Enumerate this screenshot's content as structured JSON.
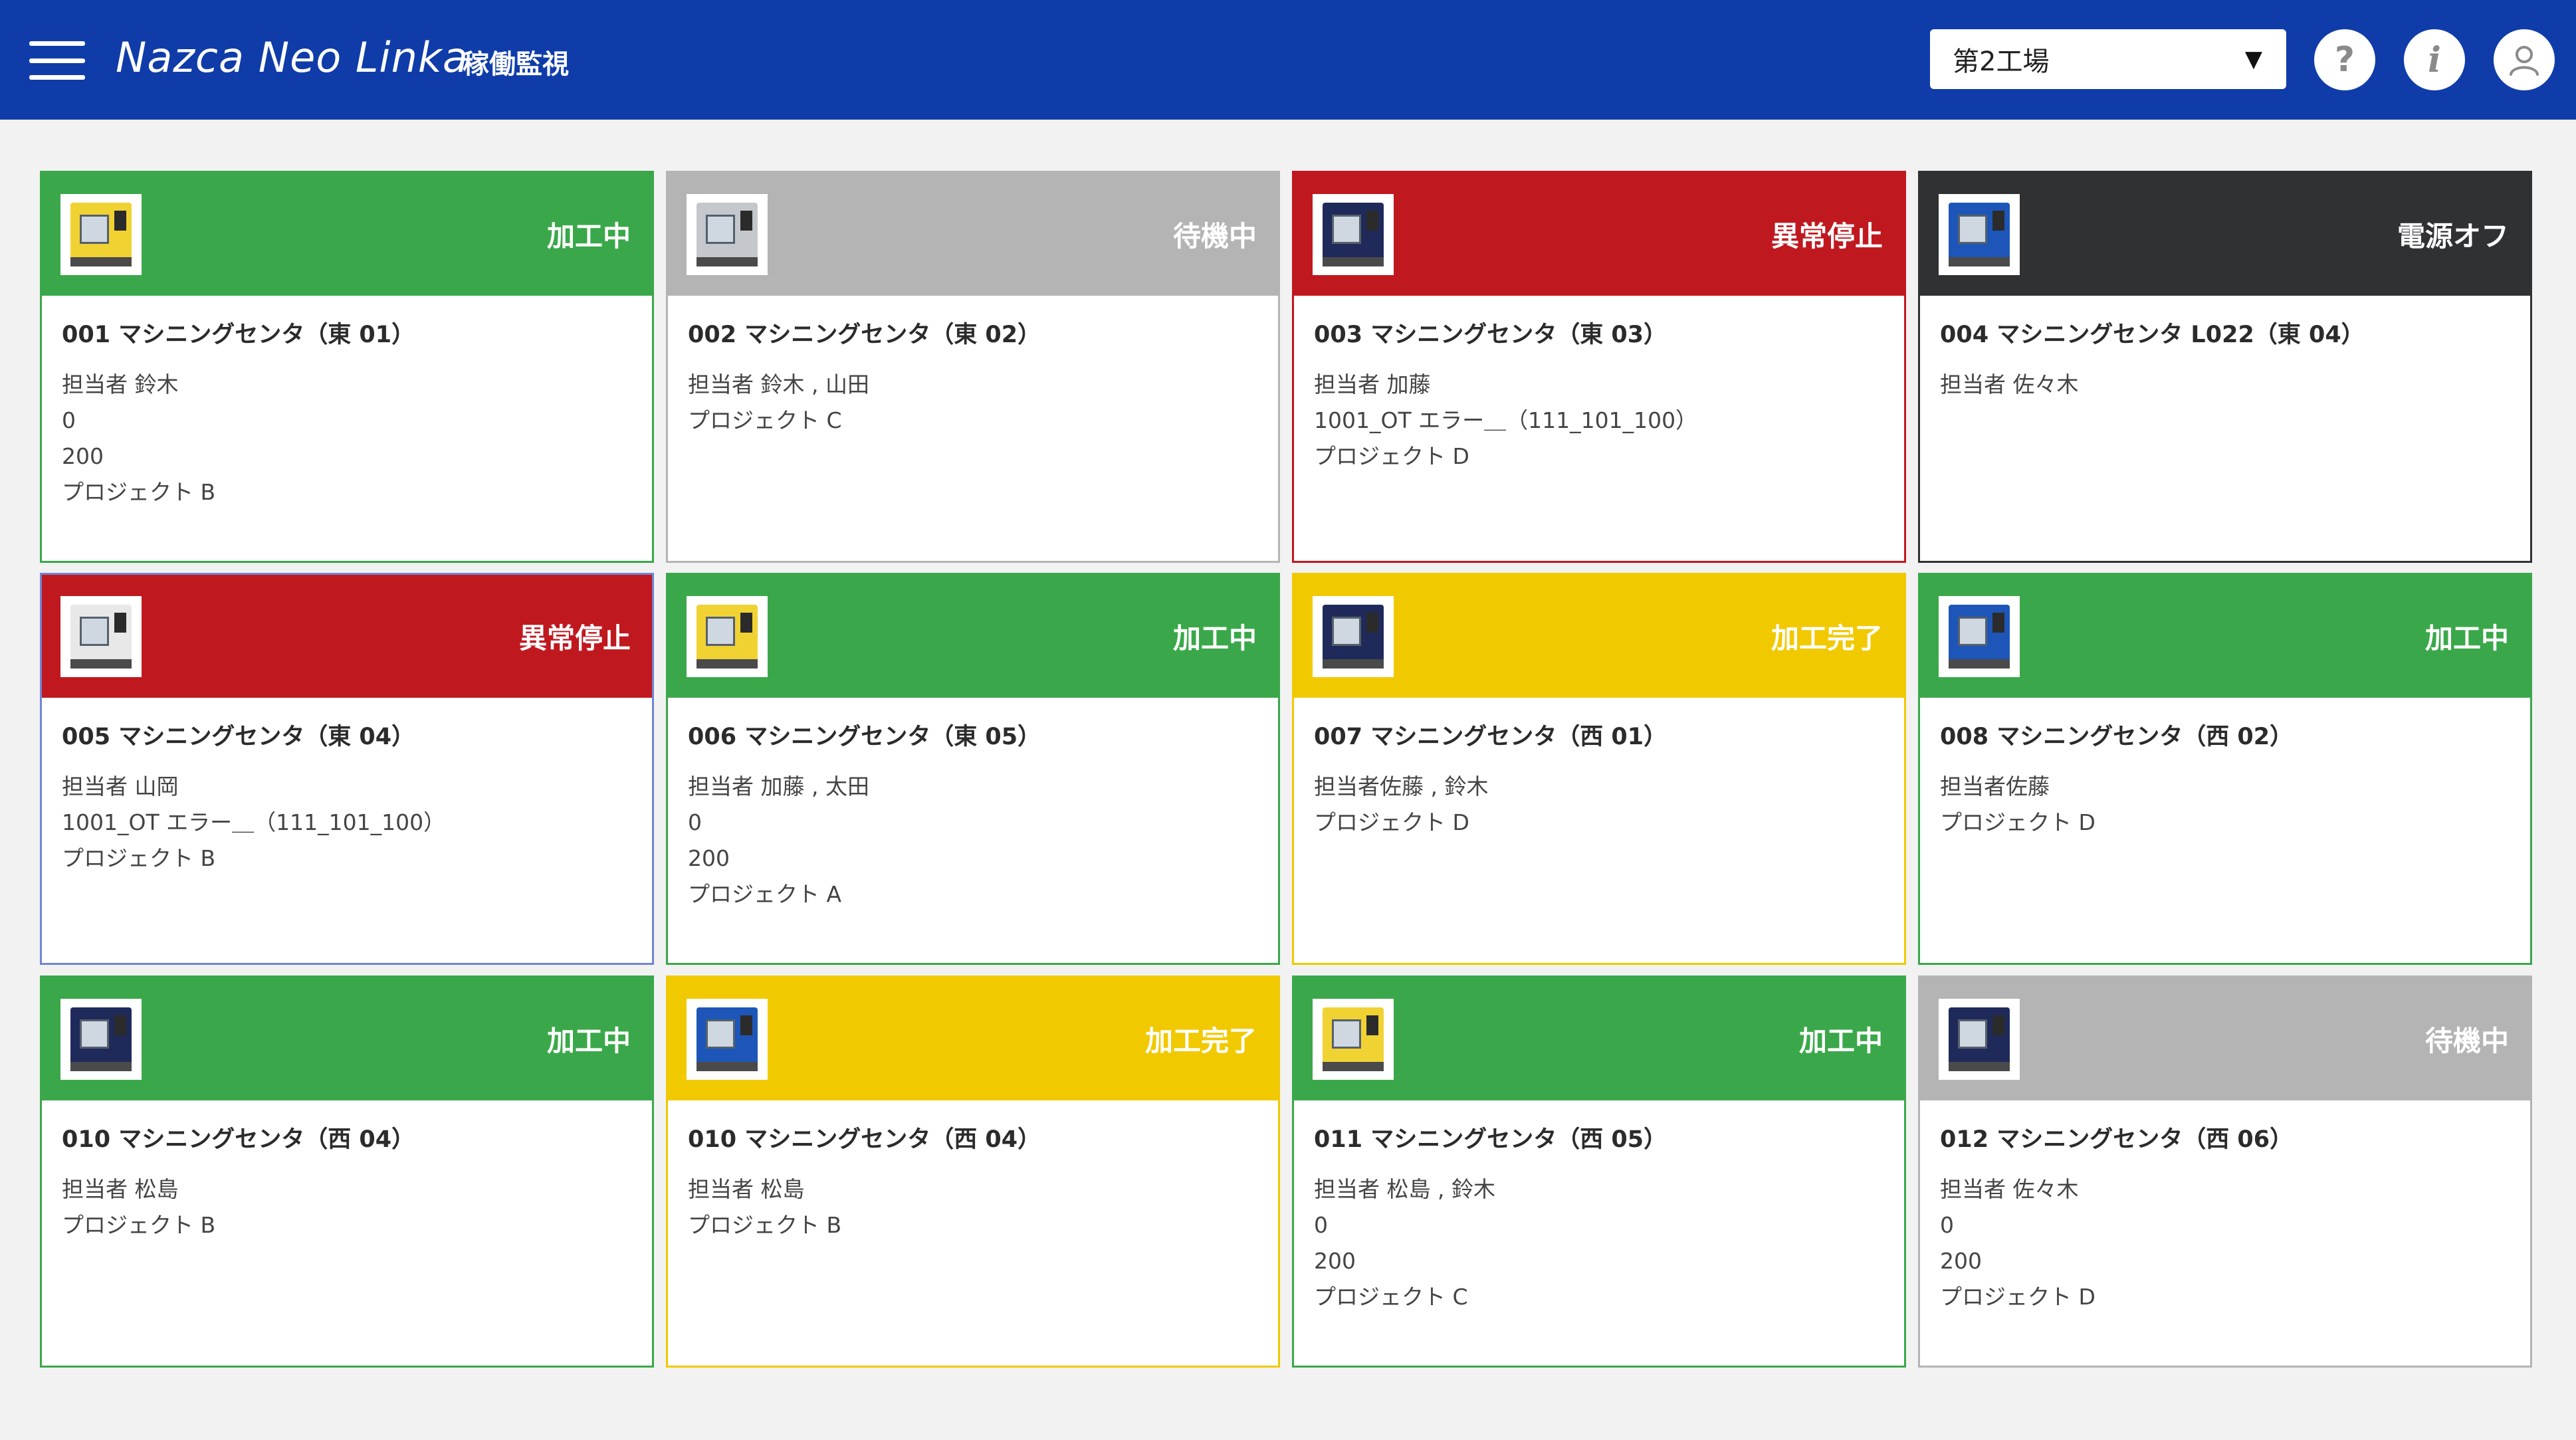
{
  "header": {
    "app_title": "Nazca Neo Linka",
    "page_name": "稼働監視",
    "factory_selected": "第2工場",
    "help_glyph": "?",
    "info_glyph": "i"
  },
  "colors": {
    "header_bg": "#0f3ca8",
    "processing": "#3aa84a",
    "standby": "#b4b4b4",
    "error_stop": "#c0181f",
    "power_off": "#2f3133",
    "completed": "#f1c900"
  },
  "cards": [
    {
      "status": "加工中",
      "status_color": "#3aa84a",
      "border": "#3aa84a",
      "machine_color": "yellow",
      "name": "001 マシニングセンタ（東 01）",
      "lines": [
        "担当者 鈴木",
        "0",
        "200",
        "プロジェクト B"
      ]
    },
    {
      "status": "待機中",
      "status_color": "#b4b4b4",
      "border": "#b4b4b4",
      "machine_color": "grey",
      "name": "002 マシニングセンタ（東 02）",
      "lines": [
        "担当者 鈴木 , 山田",
        "プロジェクト C"
      ]
    },
    {
      "status": "異常停止",
      "status_color": "#c0181f",
      "border": "#c0181f",
      "machine_color": "navy",
      "name": "003 マシニングセンタ（東 03）",
      "lines": [
        "担当者 加藤",
        "1001_OT エラー＿（111_101_100）",
        "プロジェクト D"
      ]
    },
    {
      "status": "電源オフ",
      "status_color": "#2f3133",
      "border": "#2f3133",
      "machine_color": "blue",
      "name": "004 マシニングセンタ L022（東 04）",
      "lines": [
        "担当者 佐々木"
      ]
    },
    {
      "status": "異常停止",
      "status_color": "#c0181f",
      "border": "#6f86d6",
      "machine_color": "white",
      "name": "005 マシニングセンタ（東 04）",
      "lines": [
        "担当者 山岡",
        "1001_OT エラー＿（111_101_100）",
        "プロジェクト B"
      ]
    },
    {
      "status": "加工中",
      "status_color": "#3aa84a",
      "border": "#3aa84a",
      "machine_color": "yellow",
      "name": "006 マシニングセンタ（東 05）",
      "lines": [
        "担当者 加藤 , 太田",
        "0",
        "200",
        "プロジェクト A"
      ]
    },
    {
      "status": "加工完了",
      "status_color": "#f1c900",
      "border": "#f1c900",
      "machine_color": "navy",
      "name": "007 マシニングセンタ（西 01）",
      "lines": [
        "担当者佐藤 , 鈴木",
        "プロジェクト D"
      ]
    },
    {
      "status": "加工中",
      "status_color": "#3aa84a",
      "border": "#3aa84a",
      "machine_color": "blue",
      "name": "008 マシニングセンタ（西 02）",
      "lines": [
        "担当者佐藤",
        "プロジェクト D"
      ]
    },
    {
      "status": "加工中",
      "status_color": "#3aa84a",
      "border": "#3aa84a",
      "machine_color": "navy",
      "name": "010 マシニングセンタ（西 04）",
      "lines": [
        "担当者 松島",
        "プロジェクト B"
      ]
    },
    {
      "status": "加工完了",
      "status_color": "#f1c900",
      "border": "#f1c900",
      "machine_color": "blue",
      "name": "010 マシニングセンタ（西 04）",
      "lines": [
        "担当者 松島",
        "プロジェクト B"
      ]
    },
    {
      "status": "加工中",
      "status_color": "#3aa84a",
      "border": "#3aa84a",
      "machine_color": "yellow",
      "name": "011 マシニングセンタ（西 05）",
      "lines": [
        "担当者 松島 , 鈴木",
        "0",
        "200",
        "プロジェクト C"
      ]
    },
    {
      "status": "待機中",
      "status_color": "#b4b4b4",
      "border": "#b4b4b4",
      "machine_color": "navy",
      "name": "012 マシニングセンタ（西 06）",
      "lines": [
        "担当者 佐々木",
        "0",
        "200",
        "プロジェクト D"
      ]
    }
  ]
}
